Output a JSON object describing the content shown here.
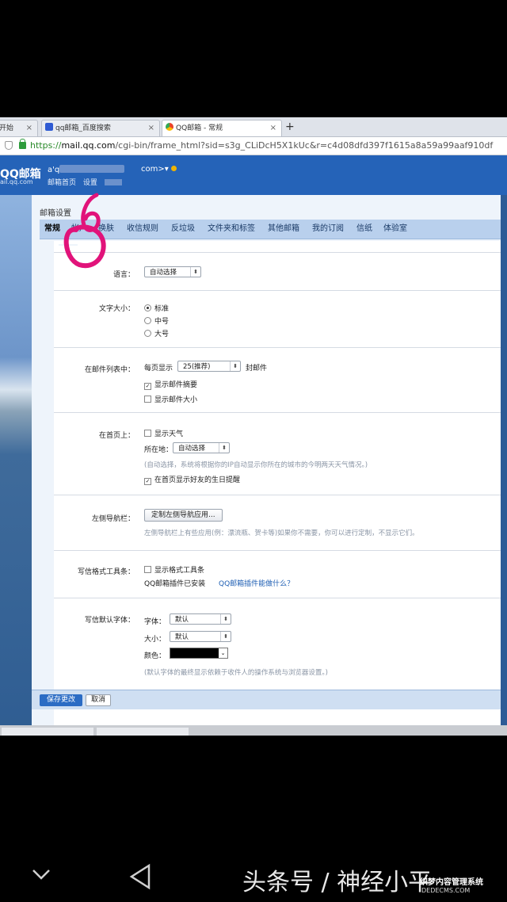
{
  "browser": {
    "tabs": [
      {
        "label": "开始",
        "active": false
      },
      {
        "label": "qq邮箱_百度搜索",
        "active": false
      },
      {
        "label": "QQ邮箱 - 常规",
        "active": true
      }
    ],
    "new_tab": "+",
    "url_scheme": "https://",
    "url_host": "mail.qq.com",
    "url_rest": "/cgi-bin/frame_html?sid=s3g_CLiDcH5X1kUc&r=c4d08dfd397f1615a8a59a99aaf910df"
  },
  "header": {
    "logo": "QQ邮箱",
    "logo_sub": "ail.qq.com",
    "account_prefix": "a'q",
    "account_suffix": "com>",
    "links": [
      "邮箱首页",
      "设置"
    ]
  },
  "settings": {
    "title": "邮箱设置",
    "tabs": [
      "常规",
      "帐户",
      "换肤",
      "收信规则",
      "反垃圾",
      "文件夹和标签",
      "其他邮箱",
      "我的订阅",
      "信纸",
      "体验室"
    ],
    "language": {
      "label": "语言：",
      "value": "自动选择"
    },
    "font_size": {
      "label": "文字大小：",
      "options": [
        "标准",
        "中号",
        "大号"
      ],
      "selected": "标准"
    },
    "mail_list": {
      "label": "在邮件列表中：",
      "per_page_prefix": "每页显示",
      "per_page_value": "25(推荐)",
      "per_page_suffix": "封邮件",
      "show_summary": "显示邮件摘要",
      "show_size": "显示邮件大小"
    },
    "home_page": {
      "label": "在首页上：",
      "show_weather": "显示天气",
      "location_label": "所在地：",
      "location_value": "自动选择",
      "location_hint": "(自动选择，系统将根据你的IP自动显示你所在的城市的今明两天天气情况。)",
      "birthday": "在首页显示好友的生日提醒"
    },
    "left_nav": {
      "label": "左侧导航栏：",
      "button": "定制左侧导航应用...",
      "hint": "左侧导航栏上有些应用(例：漂流瓶、贺卡等)如果你不需要，你可以进行定制，不显示它们。"
    },
    "format_toolbar": {
      "label": "写信格式工具条：",
      "show_toolbar": "显示格式工具条",
      "plugin_installed": "QQ邮箱插件已安装",
      "plugin_link": "QQ邮箱插件能做什么？"
    },
    "default_font": {
      "label": "写信默认字体：",
      "font_label": "字体：",
      "font_value": "默认",
      "size_label": "大小：",
      "size_value": "默认",
      "color_label": "颜色：",
      "hint": "(默认字体的最终显示依赖于收件人的操作系统与浏览器设置。)"
    },
    "save": "保存更改",
    "cancel": "取消"
  },
  "watermark": {
    "main": "头条号 / 神经小平",
    "site": "织梦内容管理系统",
    "site_url": "DEDECMS.COM"
  }
}
